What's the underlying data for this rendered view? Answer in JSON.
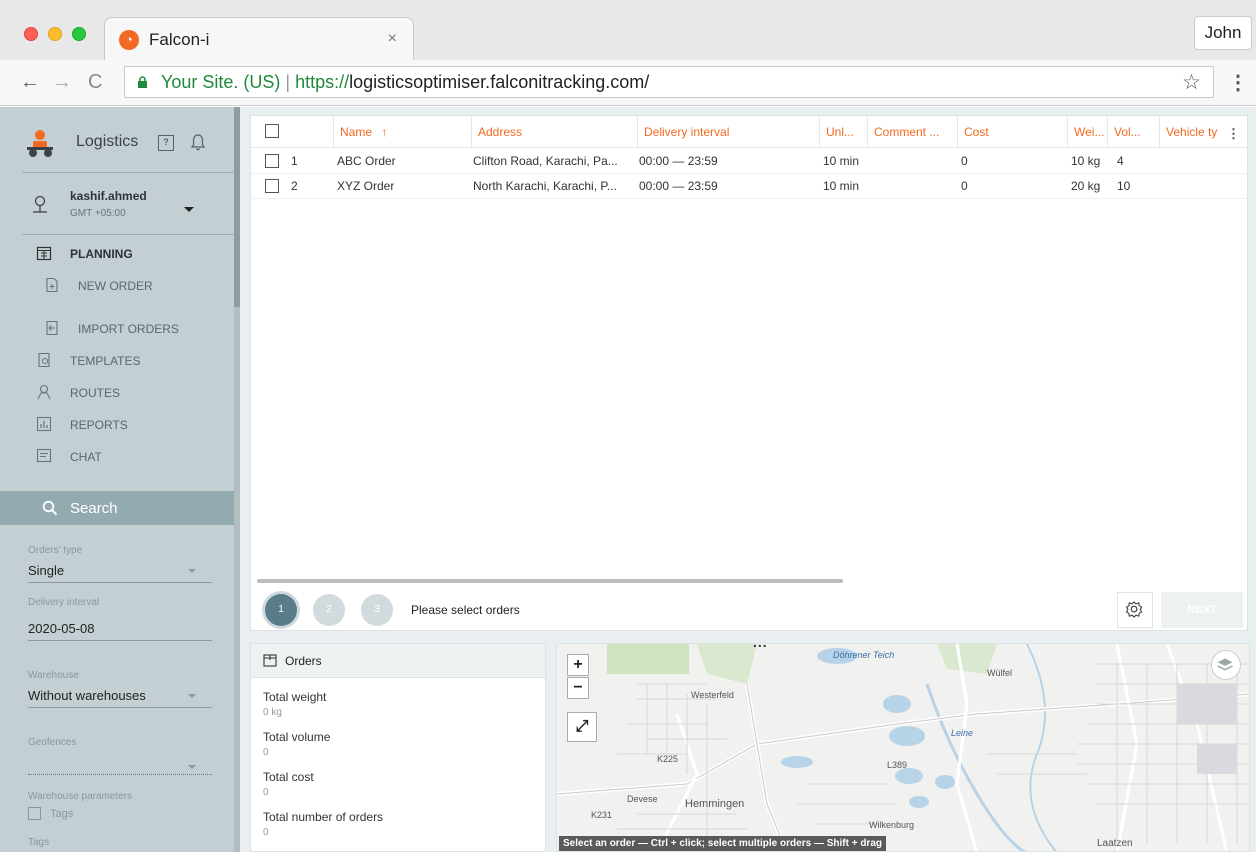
{
  "browser": {
    "tab_title": "Falcon-i",
    "tab_close": "×",
    "profile_name": "John",
    "url_secure_label": "Your Site. (US)",
    "url_separator": "|",
    "url_protocol": "https://",
    "url_host": "logisticsoptimiser.falconitracking.com/",
    "nav_back": "←",
    "nav_forward": "→",
    "nav_reload": "C",
    "star": "☆",
    "menu": "⋮"
  },
  "sidebar": {
    "brand_title": "Logistics",
    "help_icon_text": "?",
    "user": {
      "name": "kashif.ahmed",
      "timezone": "GMT +05:00"
    },
    "nav": [
      {
        "label": "PLANNING",
        "icon": "calendar-icon",
        "active": true
      },
      {
        "label": "NEW ORDER",
        "icon": "add-document-icon"
      },
      {
        "label": "IMPORT ORDERS",
        "icon": "import-icon"
      },
      {
        "label": "TEMPLATES",
        "icon": "template-icon"
      },
      {
        "label": "ROUTES",
        "icon": "route-icon"
      },
      {
        "label": "REPORTS",
        "icon": "report-icon"
      },
      {
        "label": "CHAT",
        "icon": "chat-icon"
      }
    ],
    "search_label": "Search",
    "filters": {
      "orders_type": {
        "label": "Orders' type",
        "value": "Single"
      },
      "delivery_interval": {
        "label": "Delivery interval",
        "value": "2020-05-08"
      },
      "warehouse": {
        "label": "Warehouse",
        "value": "Without warehouses"
      },
      "geofences": {
        "label": "Geofences",
        "value": ""
      },
      "warehouse_params": {
        "label": "Warehouse parameters",
        "tags_checkbox": "Tags"
      },
      "tags": {
        "label": "Tags"
      }
    }
  },
  "table": {
    "columns": [
      "Name",
      "Address",
      "Delivery interval",
      "Unl...",
      "Comment ...",
      "Cost",
      "Wei...",
      "Vol...",
      "Vehicle ty"
    ],
    "sort_indicator": "↑",
    "rows": [
      {
        "num": "1",
        "name": "ABC Order",
        "address": "Clifton Road, Karachi, Pa...",
        "interval": "00:00 — 23:59",
        "unload": "10 min",
        "comment": "",
        "cost": "0",
        "weight": "10 kg",
        "volume": "4",
        "vehicle": ""
      },
      {
        "num": "2",
        "name": "XYZ Order",
        "address": "North Karachi, Karachi, P...",
        "interval": "00:00 — 23:59",
        "unload": "10 min",
        "comment": "",
        "cost": "0",
        "weight": "20 kg",
        "volume": "10",
        "vehicle": ""
      }
    ],
    "more": "⋮"
  },
  "steps": {
    "items": [
      "1",
      "2",
      "3"
    ],
    "current": 1,
    "message": "Please select orders",
    "next_label": "NEXT"
  },
  "orders_summary": {
    "title": "Orders",
    "total_weight": {
      "label": "Total weight",
      "value": "0 kg"
    },
    "total_volume": {
      "label": "Total volume",
      "value": "0"
    },
    "total_cost": {
      "label": "Total cost",
      "value": "0"
    },
    "total_orders": {
      "label": "Total number of orders",
      "value": "0"
    }
  },
  "map": {
    "zoom_in": "+",
    "zoom_out": "−",
    "fullscreen": "⤢",
    "dots": "...",
    "hint": "Select an order — Ctrl + click; select multiple orders — Shift + drag",
    "labels": [
      "Döhrener Teich",
      "Wülfel",
      "Westerfeld",
      "Devese",
      "Hemmingen",
      "Wilkenburg",
      "Laatzen",
      "Leine",
      "K225",
      "K231",
      "L389"
    ]
  },
  "colors": {
    "accent": "#f26a21",
    "sidebar_bg": "#c3cfd3",
    "search_bg": "#94aab1",
    "step_active": "#597b8a"
  }
}
